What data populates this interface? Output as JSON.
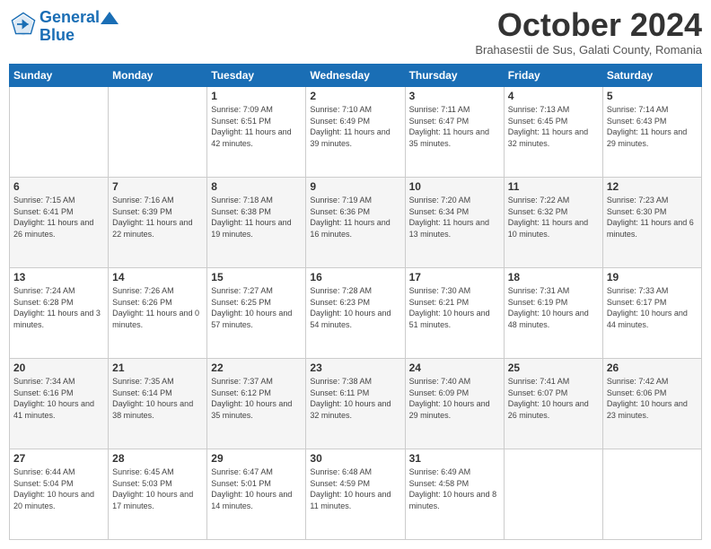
{
  "header": {
    "logo_line1": "General",
    "logo_line2": "Blue",
    "month": "October 2024",
    "location": "Brahasestii de Sus, Galati County, Romania"
  },
  "days_of_week": [
    "Sunday",
    "Monday",
    "Tuesday",
    "Wednesday",
    "Thursday",
    "Friday",
    "Saturday"
  ],
  "weeks": [
    [
      {
        "day": "",
        "sunrise": "",
        "sunset": "",
        "daylight": ""
      },
      {
        "day": "",
        "sunrise": "",
        "sunset": "",
        "daylight": ""
      },
      {
        "day": "1",
        "sunrise": "Sunrise: 7:09 AM",
        "sunset": "Sunset: 6:51 PM",
        "daylight": "Daylight: 11 hours and 42 minutes."
      },
      {
        "day": "2",
        "sunrise": "Sunrise: 7:10 AM",
        "sunset": "Sunset: 6:49 PM",
        "daylight": "Daylight: 11 hours and 39 minutes."
      },
      {
        "day": "3",
        "sunrise": "Sunrise: 7:11 AM",
        "sunset": "Sunset: 6:47 PM",
        "daylight": "Daylight: 11 hours and 35 minutes."
      },
      {
        "day": "4",
        "sunrise": "Sunrise: 7:13 AM",
        "sunset": "Sunset: 6:45 PM",
        "daylight": "Daylight: 11 hours and 32 minutes."
      },
      {
        "day": "5",
        "sunrise": "Sunrise: 7:14 AM",
        "sunset": "Sunset: 6:43 PM",
        "daylight": "Daylight: 11 hours and 29 minutes."
      }
    ],
    [
      {
        "day": "6",
        "sunrise": "Sunrise: 7:15 AM",
        "sunset": "Sunset: 6:41 PM",
        "daylight": "Daylight: 11 hours and 26 minutes."
      },
      {
        "day": "7",
        "sunrise": "Sunrise: 7:16 AM",
        "sunset": "Sunset: 6:39 PM",
        "daylight": "Daylight: 11 hours and 22 minutes."
      },
      {
        "day": "8",
        "sunrise": "Sunrise: 7:18 AM",
        "sunset": "Sunset: 6:38 PM",
        "daylight": "Daylight: 11 hours and 19 minutes."
      },
      {
        "day": "9",
        "sunrise": "Sunrise: 7:19 AM",
        "sunset": "Sunset: 6:36 PM",
        "daylight": "Daylight: 11 hours and 16 minutes."
      },
      {
        "day": "10",
        "sunrise": "Sunrise: 7:20 AM",
        "sunset": "Sunset: 6:34 PM",
        "daylight": "Daylight: 11 hours and 13 minutes."
      },
      {
        "day": "11",
        "sunrise": "Sunrise: 7:22 AM",
        "sunset": "Sunset: 6:32 PM",
        "daylight": "Daylight: 11 hours and 10 minutes."
      },
      {
        "day": "12",
        "sunrise": "Sunrise: 7:23 AM",
        "sunset": "Sunset: 6:30 PM",
        "daylight": "Daylight: 11 hours and 6 minutes."
      }
    ],
    [
      {
        "day": "13",
        "sunrise": "Sunrise: 7:24 AM",
        "sunset": "Sunset: 6:28 PM",
        "daylight": "Daylight: 11 hours and 3 minutes."
      },
      {
        "day": "14",
        "sunrise": "Sunrise: 7:26 AM",
        "sunset": "Sunset: 6:26 PM",
        "daylight": "Daylight: 11 hours and 0 minutes."
      },
      {
        "day": "15",
        "sunrise": "Sunrise: 7:27 AM",
        "sunset": "Sunset: 6:25 PM",
        "daylight": "Daylight: 10 hours and 57 minutes."
      },
      {
        "day": "16",
        "sunrise": "Sunrise: 7:28 AM",
        "sunset": "Sunset: 6:23 PM",
        "daylight": "Daylight: 10 hours and 54 minutes."
      },
      {
        "day": "17",
        "sunrise": "Sunrise: 7:30 AM",
        "sunset": "Sunset: 6:21 PM",
        "daylight": "Daylight: 10 hours and 51 minutes."
      },
      {
        "day": "18",
        "sunrise": "Sunrise: 7:31 AM",
        "sunset": "Sunset: 6:19 PM",
        "daylight": "Daylight: 10 hours and 48 minutes."
      },
      {
        "day": "19",
        "sunrise": "Sunrise: 7:33 AM",
        "sunset": "Sunset: 6:17 PM",
        "daylight": "Daylight: 10 hours and 44 minutes."
      }
    ],
    [
      {
        "day": "20",
        "sunrise": "Sunrise: 7:34 AM",
        "sunset": "Sunset: 6:16 PM",
        "daylight": "Daylight: 10 hours and 41 minutes."
      },
      {
        "day": "21",
        "sunrise": "Sunrise: 7:35 AM",
        "sunset": "Sunset: 6:14 PM",
        "daylight": "Daylight: 10 hours and 38 minutes."
      },
      {
        "day": "22",
        "sunrise": "Sunrise: 7:37 AM",
        "sunset": "Sunset: 6:12 PM",
        "daylight": "Daylight: 10 hours and 35 minutes."
      },
      {
        "day": "23",
        "sunrise": "Sunrise: 7:38 AM",
        "sunset": "Sunset: 6:11 PM",
        "daylight": "Daylight: 10 hours and 32 minutes."
      },
      {
        "day": "24",
        "sunrise": "Sunrise: 7:40 AM",
        "sunset": "Sunset: 6:09 PM",
        "daylight": "Daylight: 10 hours and 29 minutes."
      },
      {
        "day": "25",
        "sunrise": "Sunrise: 7:41 AM",
        "sunset": "Sunset: 6:07 PM",
        "daylight": "Daylight: 10 hours and 26 minutes."
      },
      {
        "day": "26",
        "sunrise": "Sunrise: 7:42 AM",
        "sunset": "Sunset: 6:06 PM",
        "daylight": "Daylight: 10 hours and 23 minutes."
      }
    ],
    [
      {
        "day": "27",
        "sunrise": "Sunrise: 6:44 AM",
        "sunset": "Sunset: 5:04 PM",
        "daylight": "Daylight: 10 hours and 20 minutes."
      },
      {
        "day": "28",
        "sunrise": "Sunrise: 6:45 AM",
        "sunset": "Sunset: 5:03 PM",
        "daylight": "Daylight: 10 hours and 17 minutes."
      },
      {
        "day": "29",
        "sunrise": "Sunrise: 6:47 AM",
        "sunset": "Sunset: 5:01 PM",
        "daylight": "Daylight: 10 hours and 14 minutes."
      },
      {
        "day": "30",
        "sunrise": "Sunrise: 6:48 AM",
        "sunset": "Sunset: 4:59 PM",
        "daylight": "Daylight: 10 hours and 11 minutes."
      },
      {
        "day": "31",
        "sunrise": "Sunrise: 6:49 AM",
        "sunset": "Sunset: 4:58 PM",
        "daylight": "Daylight: 10 hours and 8 minutes."
      },
      {
        "day": "",
        "sunrise": "",
        "sunset": "",
        "daylight": ""
      },
      {
        "day": "",
        "sunrise": "",
        "sunset": "",
        "daylight": ""
      }
    ]
  ]
}
